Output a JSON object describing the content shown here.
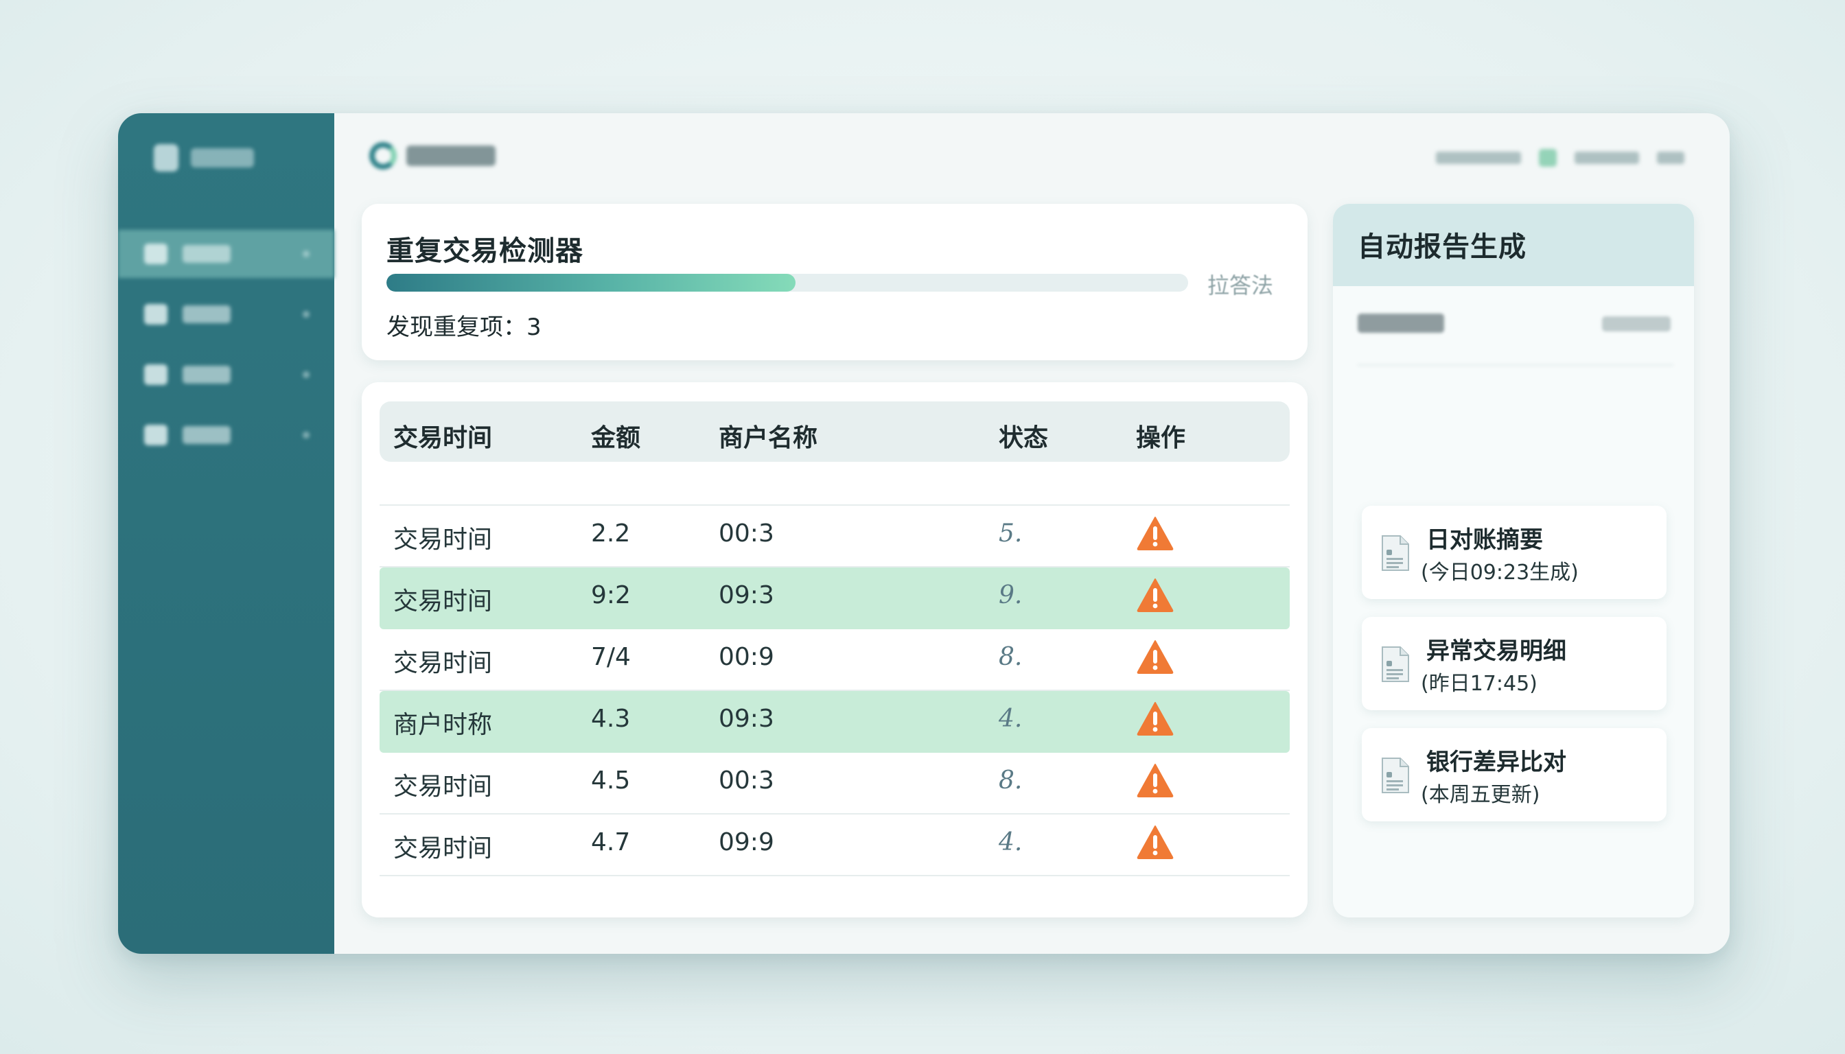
{
  "detector": {
    "title": "重复交易检测器",
    "progress_fraction": 0.51,
    "progress_label": "拉答法",
    "duplicates_found": "发现重复项：3"
  },
  "table": {
    "headers": [
      "交易时间",
      "金额",
      "商户名称",
      "状态",
      "操作"
    ],
    "rows": [
      {
        "time": "交易时间",
        "amount": "2.2",
        "merchant": "00:3",
        "status": "5.",
        "highlight": false
      },
      {
        "time": "交易时间",
        "amount": "9:2",
        "merchant": "09:3",
        "status": "9.",
        "highlight": true
      },
      {
        "time": "交易时间",
        "amount": "7/4",
        "merchant": "00:9",
        "status": "8.",
        "highlight": false
      },
      {
        "time": "商户时称",
        "amount": "4.3",
        "merchant": "09:3",
        "status": "4.",
        "highlight": true
      },
      {
        "time": "交易时间",
        "amount": "4.5",
        "merchant": "00:3",
        "status": "8.",
        "highlight": false
      },
      {
        "time": "交易时间",
        "amount": "4.7",
        "merchant": "09:9",
        "status": "4.",
        "highlight": false
      }
    ],
    "action_icon": "warning-triangle-icon"
  },
  "report": {
    "title": "自动报告生成",
    "items": [
      {
        "name": "日对账摘要",
        "sub": "(今日09:23生成)"
      },
      {
        "name": "异常交易明细",
        "sub": "(昨日17:45)"
      },
      {
        "name": "银行差异比对",
        "sub": "(本周五更新)"
      }
    ]
  },
  "colors": {
    "sidebar": "#2f7680",
    "highlight_row": "#c8ecd8",
    "warning": "#f07a35",
    "progress_start": "#2e7c87",
    "progress_end": "#85dbb9"
  }
}
